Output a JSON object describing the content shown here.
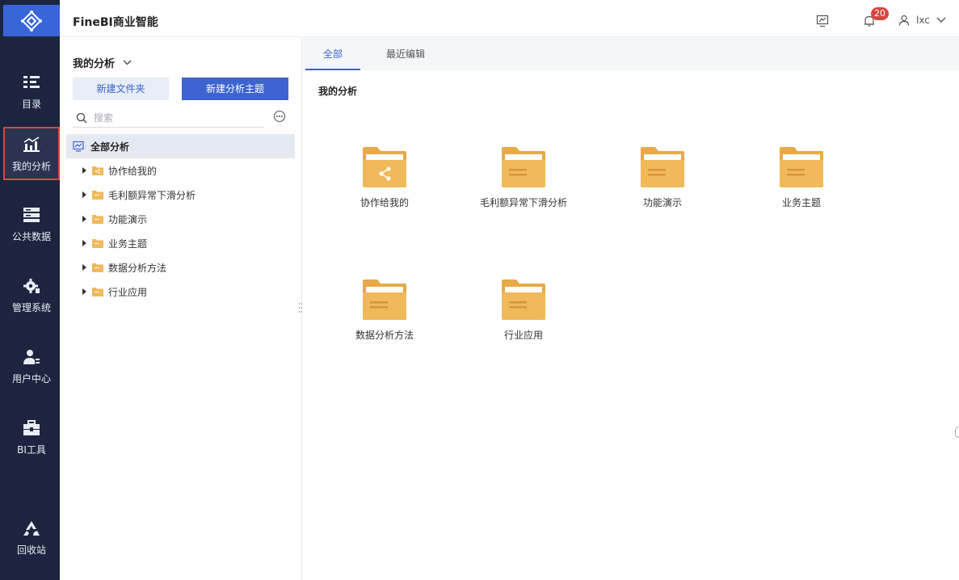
{
  "header": {
    "app_title": "FineBI商业智能",
    "notification_count": "20",
    "username": "lxc"
  },
  "rail": {
    "items": [
      {
        "label": "目录",
        "icon": "catalog-icon"
      },
      {
        "label": "我的分析",
        "icon": "chart-icon",
        "active": true
      },
      {
        "label": "公共数据",
        "icon": "database-icon"
      },
      {
        "label": "管理系统",
        "icon": "gear-icon"
      },
      {
        "label": "用户中心",
        "icon": "user-center-icon"
      },
      {
        "label": "BI工具",
        "icon": "toolbox-icon"
      },
      {
        "label": "回收站",
        "icon": "recycle-icon"
      }
    ]
  },
  "panel": {
    "title": "我的分析",
    "new_folder_label": "新建文件夹",
    "new_theme_label": "新建分析主题",
    "search_placeholder": "搜索",
    "tree_root_label": "全部分析",
    "tree_items": [
      {
        "label": "协作给我的",
        "icon": "shared-folder-icon"
      },
      {
        "label": "毛利额异常下滑分析",
        "icon": "folder-icon"
      },
      {
        "label": "功能演示",
        "icon": "folder-icon"
      },
      {
        "label": "业务主题",
        "icon": "folder-icon"
      },
      {
        "label": "数据分析方法",
        "icon": "folder-icon"
      },
      {
        "label": "行业应用",
        "icon": "folder-icon"
      }
    ]
  },
  "content": {
    "tabs": [
      {
        "label": "全部",
        "active": true
      },
      {
        "label": "最近编辑",
        "active": false
      }
    ],
    "section_title": "我的分析",
    "tiles": [
      {
        "label": "协作给我的",
        "type": "shared"
      },
      {
        "label": "毛利额异常下滑分析",
        "type": "folder"
      },
      {
        "label": "功能演示",
        "type": "folder"
      },
      {
        "label": "业务主题",
        "type": "folder"
      },
      {
        "label": "数据分析方法",
        "type": "folder"
      },
      {
        "label": "行业应用",
        "type": "folder"
      }
    ]
  },
  "colors": {
    "rail_bg": "#1c2540",
    "accent": "#3d63d1",
    "folder": "#f0b95a",
    "badge": "#d9463e"
  }
}
